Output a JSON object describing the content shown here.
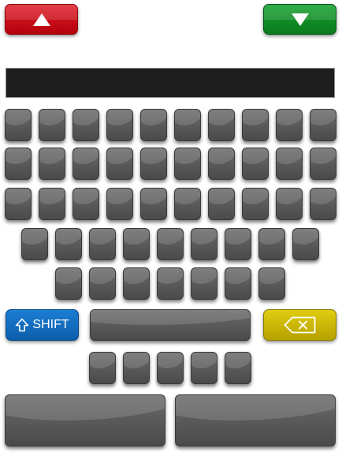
{
  "controls": {
    "up_icon": "up-arrow-icon",
    "down_icon": "down-arrow-icon",
    "up_color": "#d10f1c",
    "down_color": "#0f8e26"
  },
  "display": {
    "value": ""
  },
  "keyboard": {
    "key_color": "#555555",
    "shift_label": "SHIFT",
    "shift_icon": "shift-arrow-icon",
    "shift_color": "#1470c4",
    "backspace_icon": "backspace-icon",
    "backspace_color": "#cbb705",
    "rows": [
      {
        "name": "row-1",
        "keys": 10
      },
      {
        "name": "row-2",
        "keys": 10
      },
      {
        "name": "row-3",
        "keys": 10
      },
      {
        "name": "row-4",
        "keys": 9
      },
      {
        "name": "row-5",
        "keys": 7
      },
      {
        "name": "row-7",
        "keys": 5
      }
    ]
  }
}
